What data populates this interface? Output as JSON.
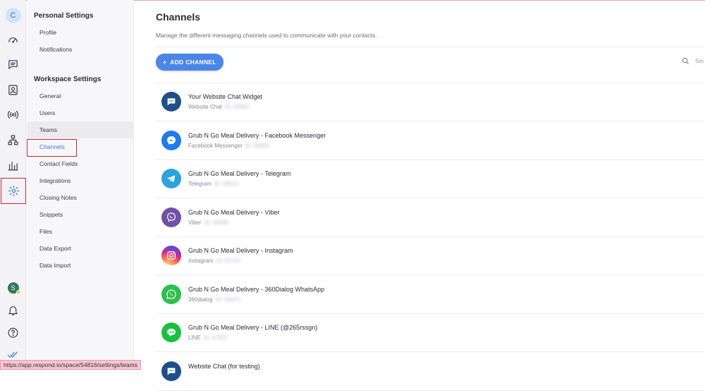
{
  "rail": {
    "avatar_initial": "C",
    "user_initial": "S"
  },
  "menu": {
    "personal_heading": "Personal Settings",
    "personal_items": [
      "Profile",
      "Notifications"
    ],
    "workspace_heading": "Workspace Settings",
    "workspace_items": [
      "General",
      "Users",
      "Teams",
      "Channels",
      "Contact Fields",
      "Integrations",
      "Closing Notes",
      "Snippets",
      "Files",
      "Data Export",
      "Data Import"
    ]
  },
  "main": {
    "title": "Channels",
    "subtitle": "Manage the different messaging channels used to communicate with your contacts.",
    "add_button": "ADD CHANNEL",
    "add_prefix": "+",
    "search_placeholder": "Search"
  },
  "channels": [
    {
      "name": "Your Website Chat Widget",
      "type": "Website Chat",
      "id": "ID: 63982",
      "icon": "chat-widget-icon",
      "color": "#1f4f8a"
    },
    {
      "name": "Grub N Go Meal Delivery - Facebook Messenger",
      "type": "Facebook Messenger",
      "id": "ID: 64893",
      "icon": "messenger-icon",
      "color": "#1e7bf2"
    },
    {
      "name": "Grub N Go Meal Delivery - Telegram",
      "type": "Telegram",
      "id": "ID: 68310",
      "icon": "telegram-icon",
      "color": "#2aa3df"
    },
    {
      "name": "Grub N Go Meal Delivery - Viber",
      "type": "Viber",
      "id": "ID: 60586",
      "icon": "viber-icon",
      "color": "#7051a8"
    },
    {
      "name": "Grub N Go Meal Delivery - Instagram",
      "type": "Instagram",
      "id": "ID: 67145",
      "icon": "instagram-icon",
      "color": "#d82d7e"
    },
    {
      "name": "Grub N Go Meal Delivery - 360Dialog WhatsApp",
      "type": "360dialog",
      "id": "ID: 69470",
      "icon": "whatsapp-icon",
      "color": "#2cc04a"
    },
    {
      "name": "Grub N Go Meal Delivery - LINE (@265rssgn)",
      "type": "LINE",
      "id": "ID: 67827",
      "icon": "line-icon",
      "color": "#17c13f"
    },
    {
      "name": "Website Chat (for testing)",
      "type": "",
      "id": "",
      "icon": "chat-widget-icon",
      "color": "#1f4f8a"
    }
  ],
  "status_url": "https://app.respond.io/space/54816/settings/teams"
}
